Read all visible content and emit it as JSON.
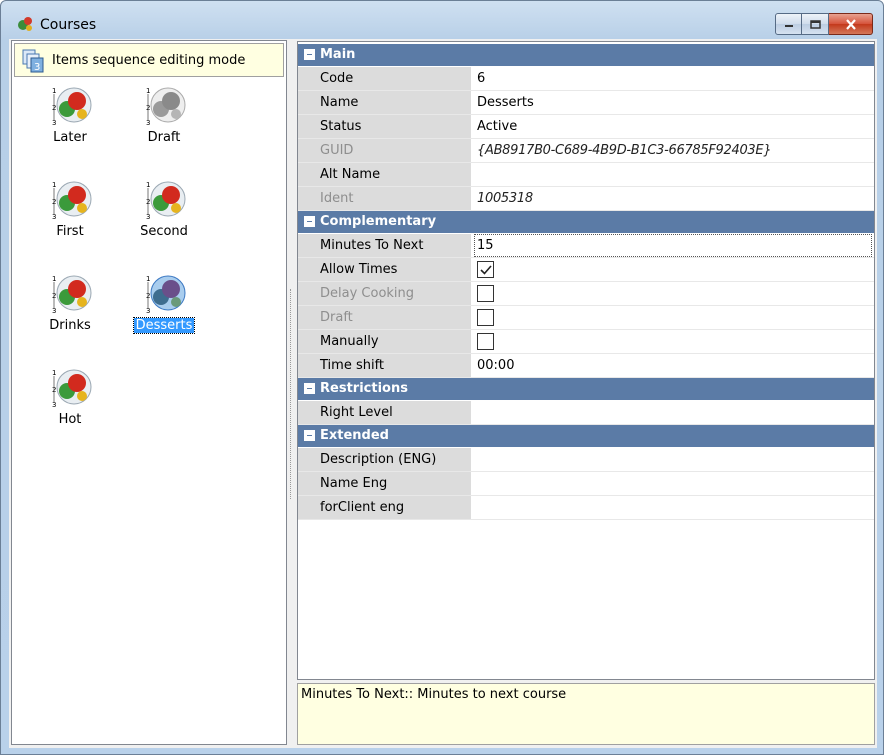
{
  "window": {
    "title": "Courses",
    "icon": "courses-app-icon",
    "buttons": [
      "minimize",
      "maximize",
      "close"
    ]
  },
  "left_panel": {
    "mode_banner": "Items sequence editing mode",
    "mode_icon": "sequence-icon",
    "tiles": [
      {
        "label": "Later",
        "icon": "course-dish-icon",
        "selected": false
      },
      {
        "label": "Draft",
        "icon": "course-dish-gray-icon",
        "selected": false
      },
      {
        "label": "First",
        "icon": "course-dish-icon",
        "selected": false
      },
      {
        "label": "Second",
        "icon": "course-dish-icon",
        "selected": false
      },
      {
        "label": "Drinks",
        "icon": "course-dish-icon",
        "selected": false
      },
      {
        "label": "Desserts",
        "icon": "course-dish-blue-icon",
        "selected": true
      },
      {
        "label": "Hot",
        "icon": "course-dish-icon",
        "selected": false
      }
    ]
  },
  "property_grid": {
    "categories": [
      {
        "label": "Main",
        "rows": [
          {
            "name": "Code",
            "value": "6",
            "readonly": false
          },
          {
            "name": "Name",
            "value": "Desserts",
            "readonly": false
          },
          {
            "name": "Status",
            "value": "Active",
            "readonly": false
          },
          {
            "name": "GUID",
            "value": "{AB8917B0-C689-4B9D-B1C3-66785F92403E}",
            "readonly": true
          },
          {
            "name": "Alt Name",
            "value": "",
            "readonly": false
          },
          {
            "name": "Ident",
            "value": "1005318",
            "readonly": true
          }
        ]
      },
      {
        "label": "Complementary",
        "rows": [
          {
            "name": "Minutes To Next",
            "value": "15",
            "readonly": false
          },
          {
            "name": "Allow Times",
            "checked": true,
            "readonly": false
          },
          {
            "name": "Delay Cooking",
            "checked": false,
            "readonly": true
          },
          {
            "name": "Draft",
            "checked": false,
            "readonly": true
          },
          {
            "name": "Manually",
            "checked": false,
            "readonly": false
          },
          {
            "name": "Time shift",
            "value": "00:00",
            "readonly": false
          }
        ]
      },
      {
        "label": "Restrictions",
        "rows": [
          {
            "name": "Right Level",
            "value": "",
            "readonly": false
          }
        ]
      },
      {
        "label": "Extended",
        "rows": [
          {
            "name": "Description (ENG)",
            "value": "",
            "readonly": false
          },
          {
            "name": "Name Eng",
            "value": "",
            "readonly": false
          },
          {
            "name": "forClient eng",
            "value": "",
            "readonly": false
          }
        ]
      }
    ]
  },
  "description_box": {
    "text": "Minutes To Next:: Minutes to next course"
  },
  "colors": {
    "category_header": "#5b7ba6",
    "selection": "#3399ff",
    "info_background": "#ffffe1"
  }
}
